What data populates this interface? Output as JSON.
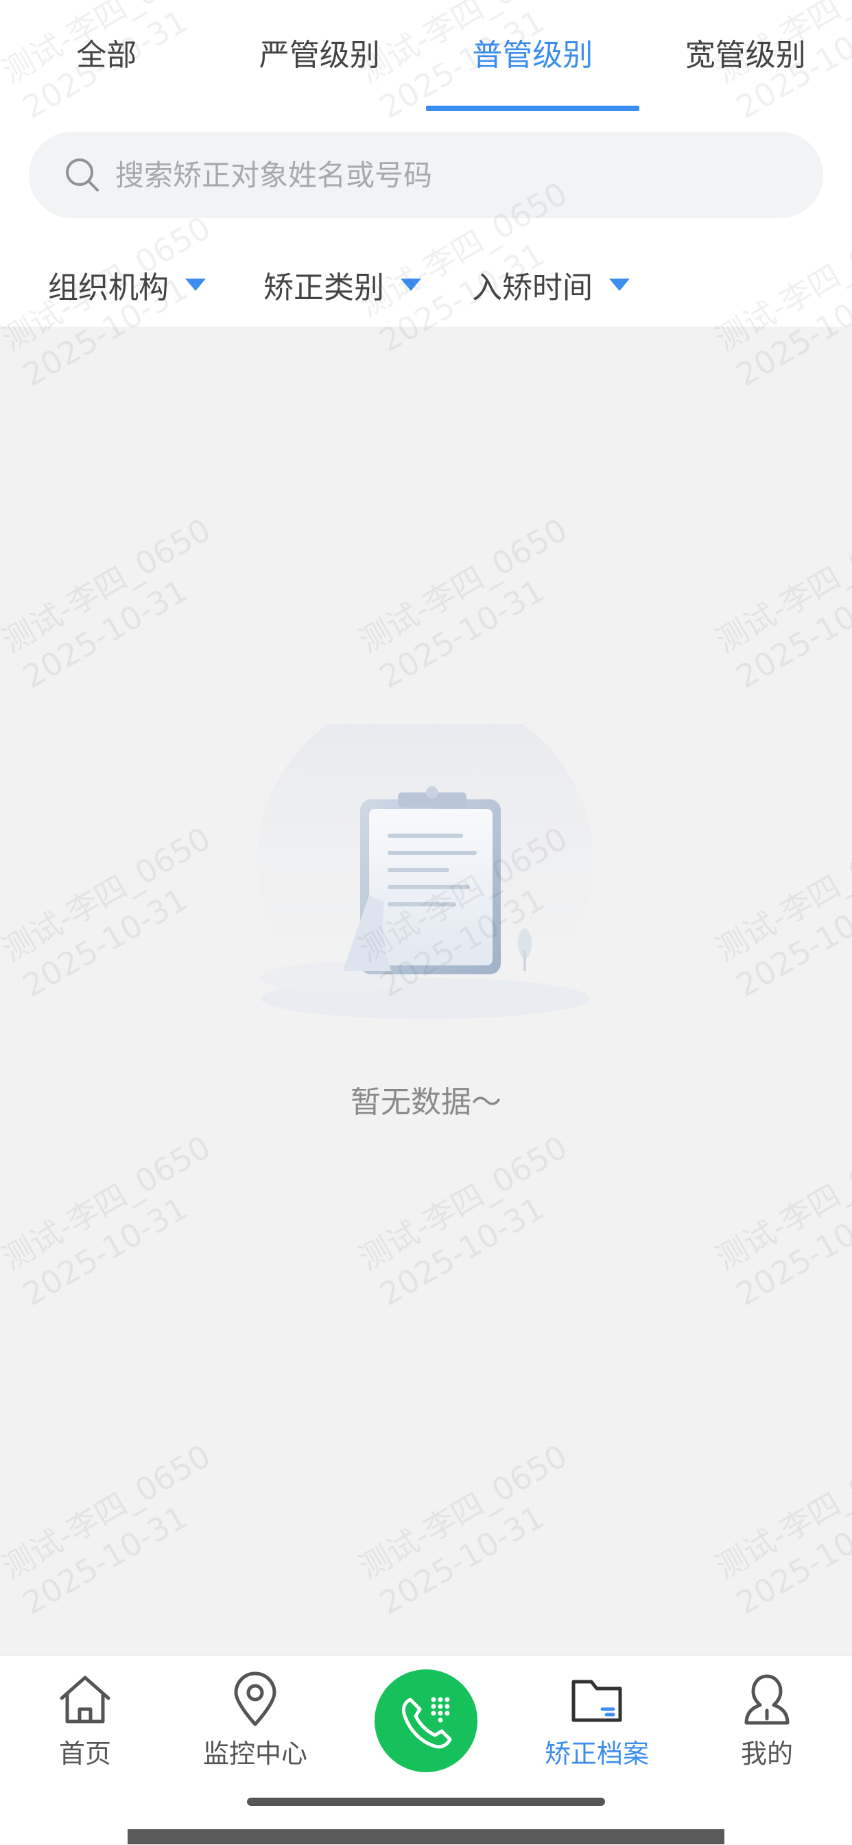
{
  "tabs": [
    {
      "label": "全部",
      "active": false
    },
    {
      "label": "严管级别",
      "active": false
    },
    {
      "label": "普管级别",
      "active": true
    },
    {
      "label": "宽管级别",
      "active": false
    }
  ],
  "search": {
    "placeholder": "搜索矫正对象姓名或号码",
    "value": ""
  },
  "filters": [
    {
      "label": "组织机构"
    },
    {
      "label": "矫正类别"
    },
    {
      "label": "入矫时间"
    }
  ],
  "empty": {
    "text": "暂无数据～"
  },
  "watermark": {
    "line1": "测试-李四_0650",
    "line2": "2025-10-31"
  },
  "bottom_nav": [
    {
      "label": "首页",
      "icon": "home-icon",
      "active": false
    },
    {
      "label": "监控中心",
      "icon": "location-pin-icon",
      "active": false
    },
    {
      "label": "",
      "icon": "phone-dialpad-icon",
      "active": false
    },
    {
      "label": "矫正档案",
      "icon": "folder-icon",
      "active": true
    },
    {
      "label": "我的",
      "icon": "user-icon",
      "active": false
    }
  ],
  "colors": {
    "accent": "#3b8ef0",
    "call_button": "#16c05a",
    "background": "#f2f2f2"
  }
}
